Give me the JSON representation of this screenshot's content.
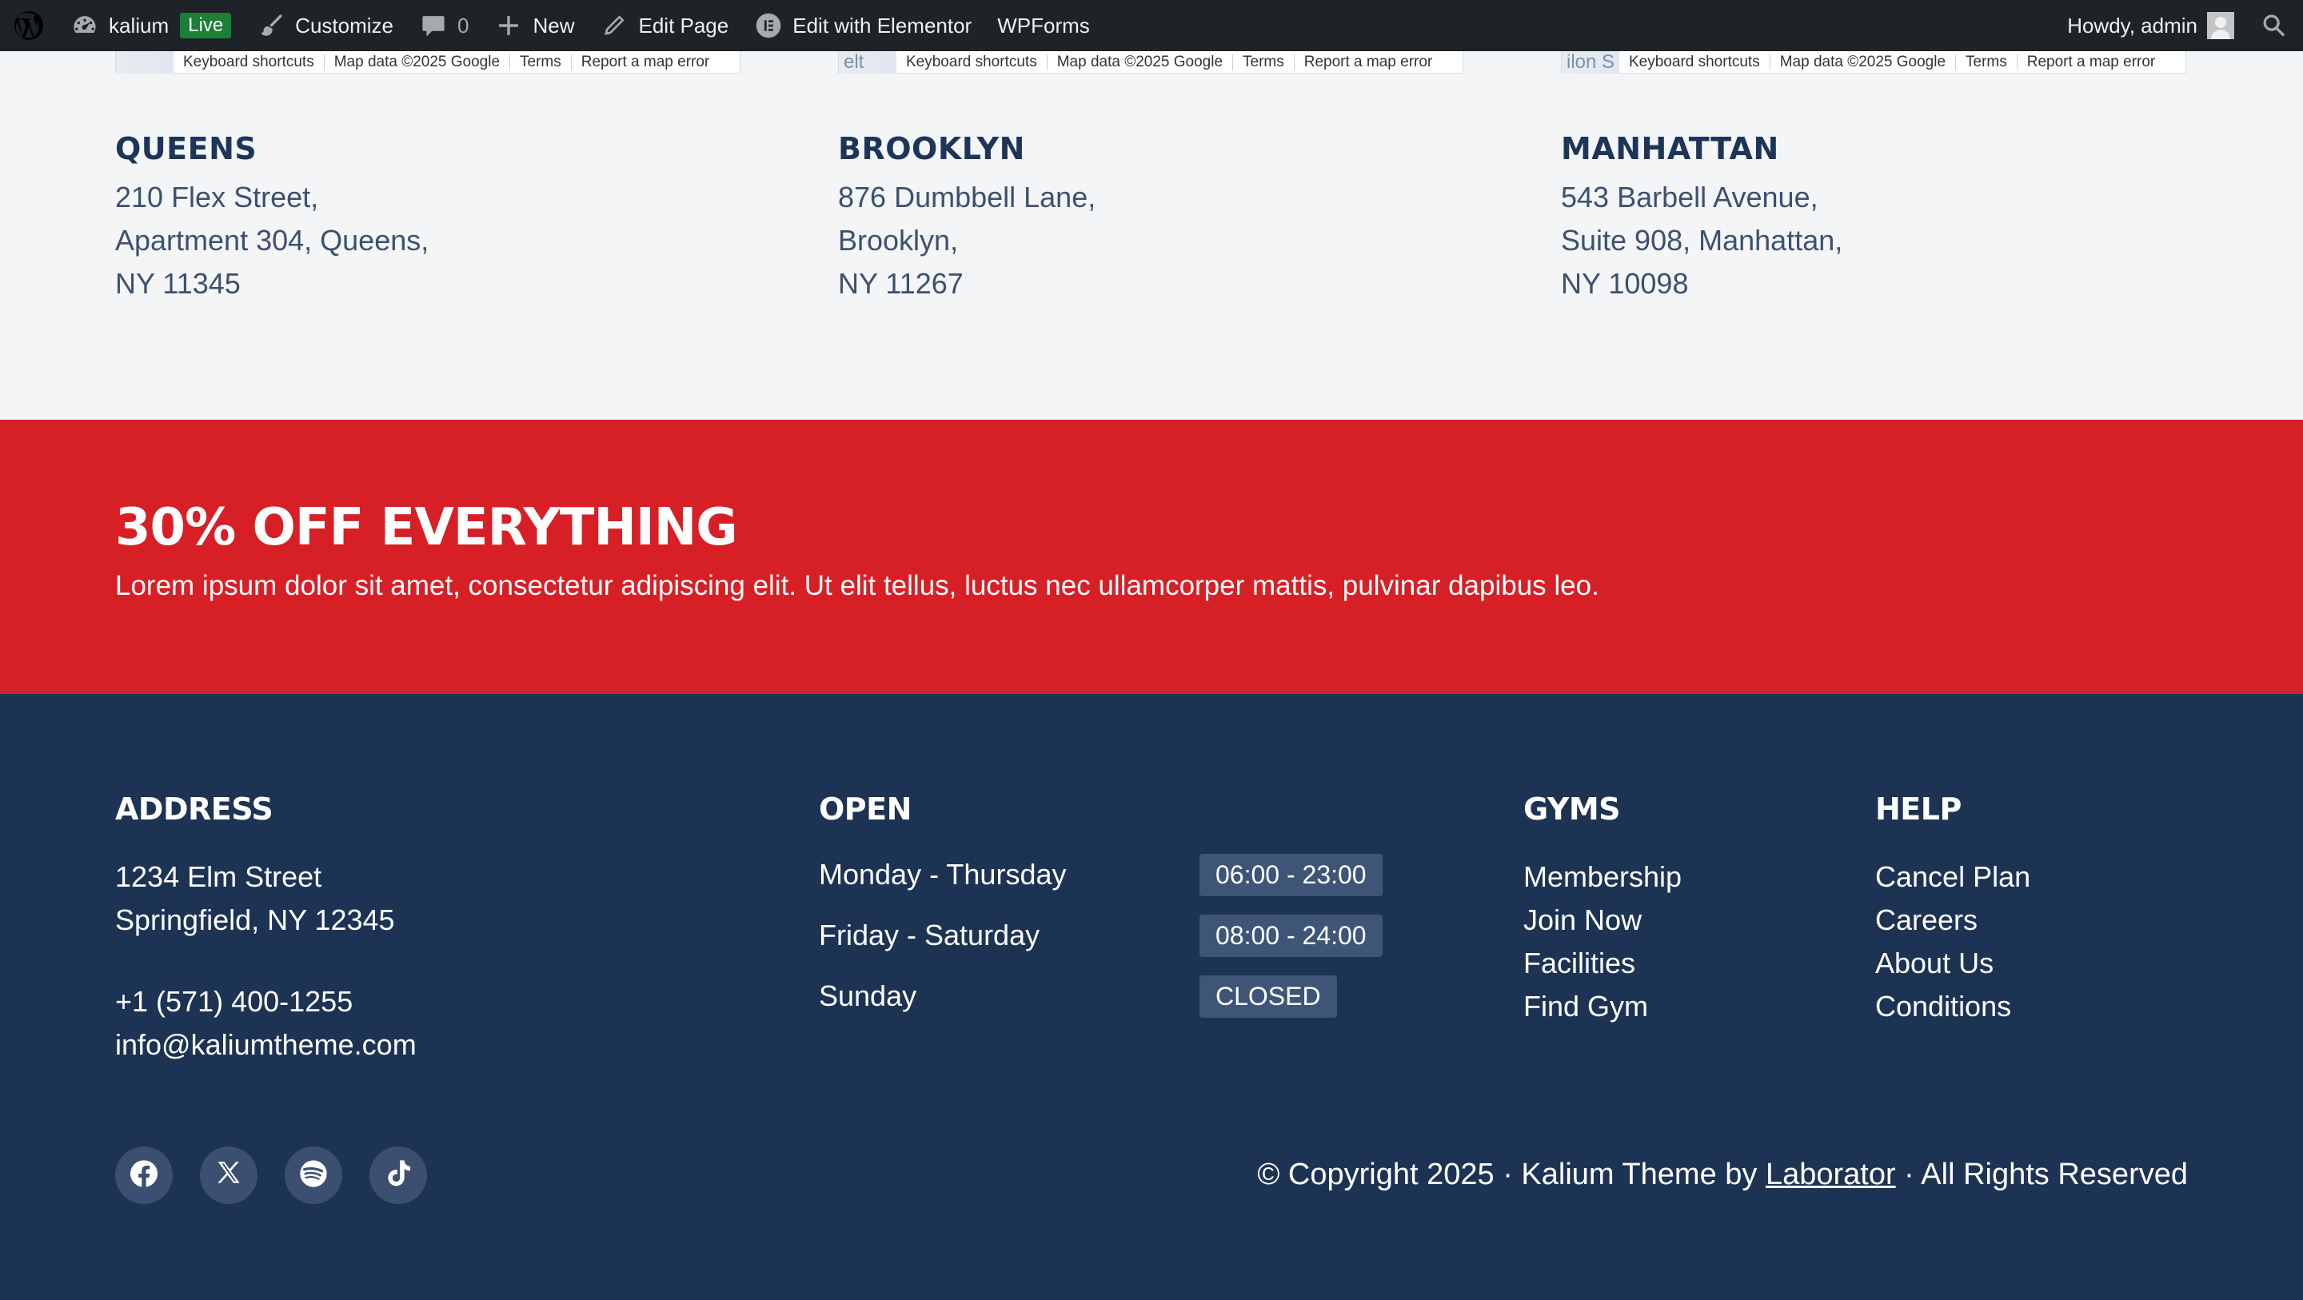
{
  "adminbar": {
    "site_name": "kalium",
    "live_badge": "Live",
    "customize": "Customize",
    "comments_count": "0",
    "new": "New",
    "edit_page": "Edit Page",
    "edit_elementor": "Edit with Elementor",
    "wpforms": "WPForms",
    "howdy": "Howdy, admin"
  },
  "maps": [
    {
      "thumb": "",
      "shortcuts": "Keyboard shortcuts",
      "map_data": "Map data ©2025 Google",
      "terms": "Terms",
      "report": "Report a map error"
    },
    {
      "thumb": "elt Hic",
      "shortcuts": "Keyboard shortcuts",
      "map_data": "Map data ©2025 Google",
      "terms": "Terms",
      "report": "Report a map error"
    },
    {
      "thumb": "ilon S",
      "shortcuts": "Keyboard shortcuts",
      "map_data": "Map data ©2025 Google",
      "terms": "Terms",
      "report": "Report a map error"
    }
  ],
  "locations": [
    {
      "name": "QUEENS",
      "line1": "210 Flex Street,",
      "line2": "Apartment 304, Queens,",
      "line3": "NY 11345"
    },
    {
      "name": "BROOKLYN",
      "line1": "876 Dumbbell Lane,",
      "line2": "Brooklyn,",
      "line3": "NY 11267"
    },
    {
      "name": "MANHATTAN",
      "line1": "543 Barbell Avenue,",
      "line2": "Suite 908, Manhattan,",
      "line3": "NY 10098"
    }
  ],
  "promo": {
    "title": "30% OFF EVERYTHING",
    "text": "Lorem ipsum dolor sit amet, consectetur adipiscing elit. Ut elit tellus, luctus nec ullamcorper mattis, pulvinar dapibus leo."
  },
  "footer": {
    "address": {
      "title": "ADDRESS",
      "street": "1234 Elm Street",
      "city": "Springfield, NY 12345",
      "phone": "+1 (571) 400-1255",
      "email": "info@kaliumtheme.com"
    },
    "open": {
      "title": "OPEN",
      "rows": [
        {
          "day": "Monday - Thursday",
          "hours": "06:00 - 23:00"
        },
        {
          "day": "Friday - Saturday",
          "hours": "08:00 - 24:00"
        },
        {
          "day": "Sunday",
          "hours": "CLOSED"
        }
      ]
    },
    "gyms": {
      "title": "GYMS",
      "links": [
        "Membership",
        "Join Now",
        "Facilities",
        "Find Gym"
      ]
    },
    "help": {
      "title": "HELP",
      "links": [
        "Cancel Plan",
        "Careers",
        "About Us",
        "Conditions"
      ]
    },
    "copyright": {
      "prefix": "© Copyright 2025 · Kalium Theme by ",
      "link": "Laborator",
      "suffix": " · All Rights Reserved"
    }
  },
  "icons": {
    "socials": [
      "facebook-icon",
      "x-icon",
      "spotify-icon",
      "tiktok-icon"
    ]
  },
  "colors": {
    "promo_bg": "#d71f26",
    "footer_bg": "#1d3354",
    "heading": "#1d3557",
    "adminbar_bg": "#1d2327"
  }
}
